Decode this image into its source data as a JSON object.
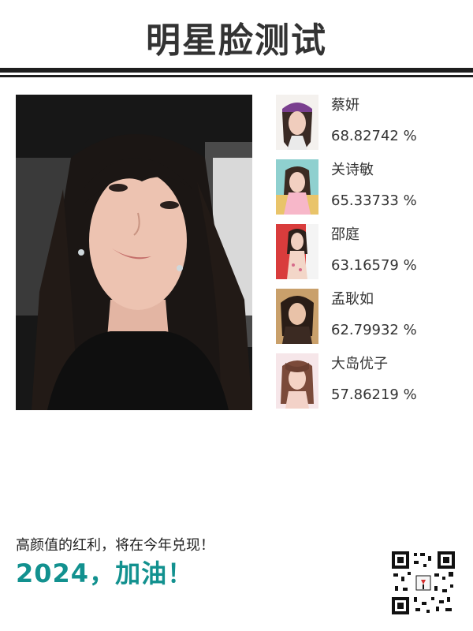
{
  "header": {
    "title": "明星脸测试"
  },
  "results": [
    {
      "name": "蔡妍",
      "score": "68.82742 %"
    },
    {
      "name": "关诗敏",
      "score": "65.33733 %"
    },
    {
      "name": "邵庭",
      "score": "63.16579 %"
    },
    {
      "name": "孟耿如",
      "score": "62.79932 %"
    },
    {
      "name": "大岛优子",
      "score": "57.86219 %"
    }
  ],
  "footer": {
    "slogan": "高颜值的红利，将在今年兑现！",
    "cheer": "2024，加油！"
  },
  "colors": {
    "accent": "#12918f",
    "text": "#333333",
    "rule": "#1e1e1e"
  }
}
